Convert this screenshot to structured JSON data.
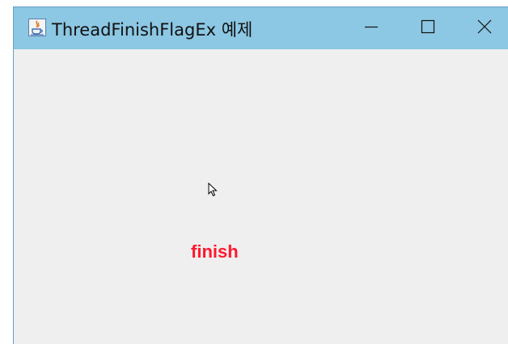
{
  "window": {
    "title": "ThreadFinishFlagEx 예제",
    "app_icon": "java-icon",
    "controls": {
      "minimize_icon": "minimize-icon",
      "maximize_icon": "maximize-icon",
      "close_icon": "close-icon"
    }
  },
  "content": {
    "status_label": "finish",
    "status_color": "#ff1a2e",
    "cursor_icon": "mouse-pointer-icon"
  },
  "colors": {
    "titlebar": "#8cc7e3",
    "background": "#efefef"
  }
}
